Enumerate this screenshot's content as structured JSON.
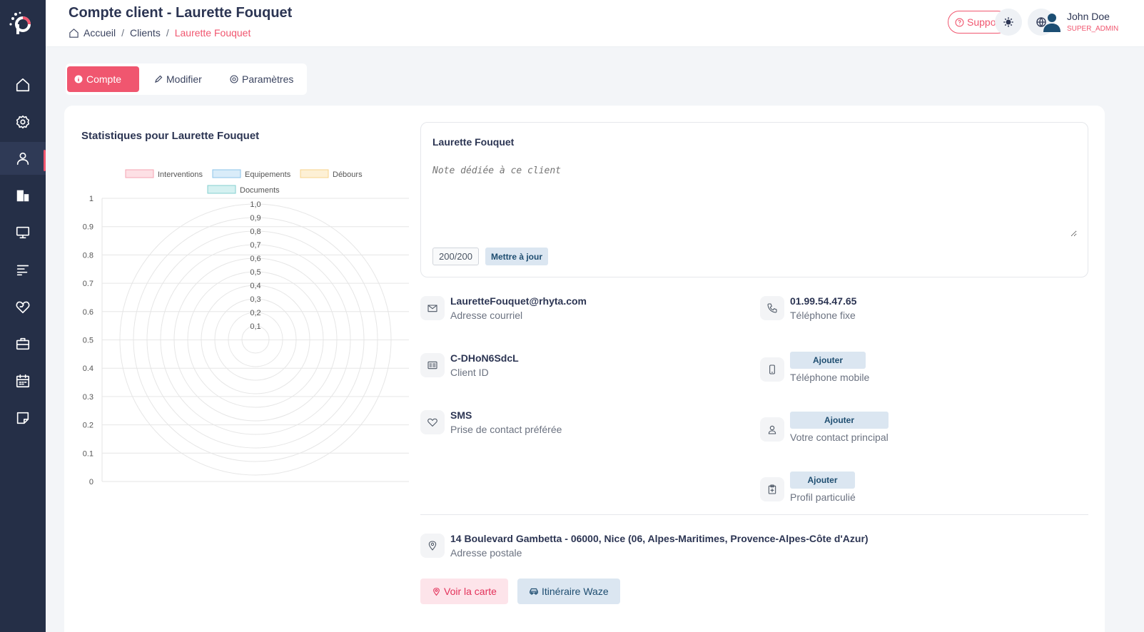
{
  "header": {
    "title": "Compte client - Laurette Fouquet",
    "breadcrumb": [
      "Accueil",
      "Clients",
      "Laurette Fouquet"
    ],
    "support_label": "Support",
    "user_name": "John Doe",
    "user_role": "SUPER_ADMIN"
  },
  "sidebar": {
    "items": [
      "home-icon",
      "settings-icon",
      "user-icon",
      "building-icon",
      "monitor-icon",
      "list-icon",
      "heart-icon",
      "briefcase-icon",
      "calendar-icon",
      "note-icon"
    ],
    "active_index": 2
  },
  "tabs": [
    {
      "label": "Compte",
      "active": true
    },
    {
      "label": "Modifier",
      "active": false
    },
    {
      "label": "Paramètres",
      "active": false
    }
  ],
  "stats": {
    "title": "Statistiques pour Laurette Fouquet"
  },
  "note": {
    "client_name": "Laurette Fouquet",
    "placeholder": "Note dédiée à ce client",
    "counter": "200/200",
    "update_label": "Mettre à jour"
  },
  "info": {
    "email": {
      "value": "LauretteFouquet@rhyta.com",
      "label": "Adresse courriel"
    },
    "phone": {
      "value": "01.99.54.47.65",
      "label": "Téléphone fixe"
    },
    "client_id": {
      "value": "C-DHoN6SdcL",
      "label": "Client ID"
    },
    "mobile": {
      "button": "Ajouter",
      "label": "Téléphone mobile"
    },
    "contact_pref": {
      "value": "SMS",
      "label": "Prise de contact préférée"
    },
    "main_contact": {
      "button": "Ajouter",
      "label": "Votre contact principal"
    },
    "profile": {
      "button": "Ajouter",
      "label": "Profil particulié"
    },
    "address": {
      "value": "14 Boulevard Gambetta - 06000, Nice (06, Alpes-Maritimes, Provence-Alpes-Côte d'Azur)",
      "label": "Adresse postale"
    }
  },
  "actions": {
    "map_label": "Voir la carte",
    "waze_label": "Itinéraire Waze"
  },
  "colors": {
    "accent": "#f0566f",
    "sidebar": "#252f47"
  },
  "chart_data": {
    "type": "radar",
    "legend": [
      {
        "name": "Interventions",
        "fill": "#fde0e5",
        "stroke": "#f5a3b2"
      },
      {
        "name": "Equipements",
        "fill": "#d9ecf9",
        "stroke": "#8cc4ea"
      },
      {
        "name": "Débours",
        "fill": "#fdf0d5",
        "stroke": "#f7d38c"
      },
      {
        "name": "Documents",
        "fill": "#d5f1f1",
        "stroke": "#84cfcf"
      }
    ],
    "y_ticks": [
      "0",
      "0.1",
      "0.2",
      "0.3",
      "0.4",
      "0.5",
      "0.6",
      "0.7",
      "0.8",
      "0.9",
      "1"
    ],
    "r_ticks": [
      "0,1",
      "0,2",
      "0,3",
      "0,4",
      "0,5",
      "0,6",
      "0,7",
      "0,8",
      "0,9",
      "1,0"
    ],
    "values": [
      0,
      0,
      0,
      0
    ],
    "ylim": [
      0,
      1
    ]
  }
}
